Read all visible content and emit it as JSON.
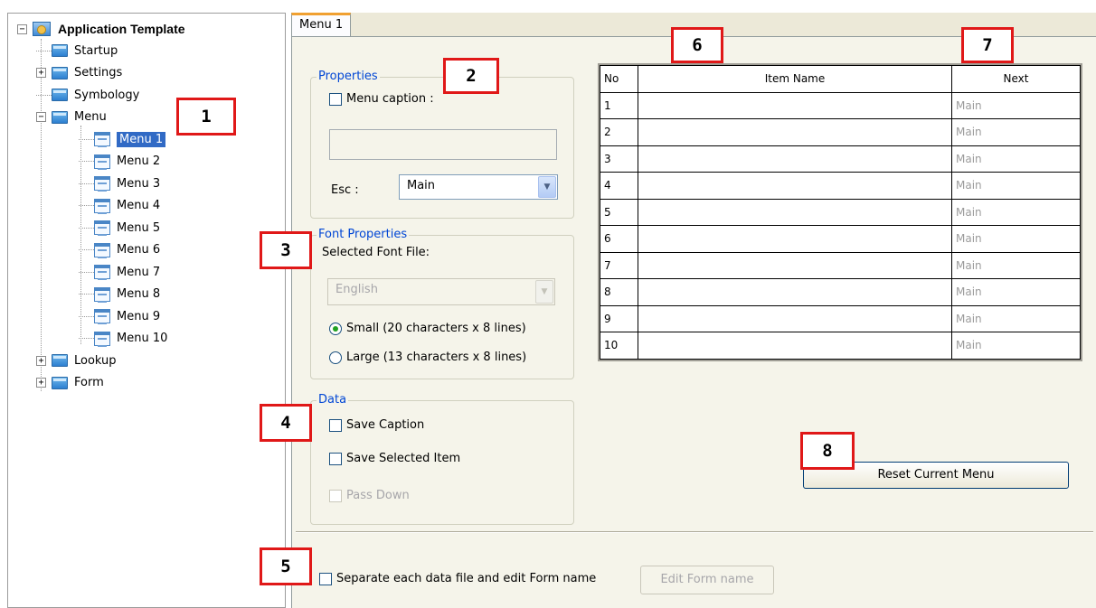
{
  "tree": {
    "root": "Application Template",
    "items": [
      {
        "label": "Startup",
        "expander": ""
      },
      {
        "label": "Settings",
        "expander": "+"
      },
      {
        "label": "Symbology",
        "expander": ""
      },
      {
        "label": "Menu",
        "expander": "−"
      }
    ],
    "menus": [
      "Menu 1",
      "Menu 2",
      "Menu 3",
      "Menu 4",
      "Menu 5",
      "Menu 6",
      "Menu 7",
      "Menu 8",
      "Menu 9",
      "Menu 10"
    ],
    "selected": "Menu 1",
    "after": [
      {
        "label": "Lookup",
        "expander": "+"
      },
      {
        "label": "Form",
        "expander": "+"
      }
    ]
  },
  "tab": {
    "label": "Menu 1"
  },
  "properties": {
    "title": "Properties",
    "menu_caption_label": "Menu caption :",
    "menu_caption_checked": false,
    "caption_value": "",
    "esc_label": "Esc :",
    "esc_value": "Main"
  },
  "font_properties": {
    "title": "Font Properties",
    "selected_font_label": "Selected Font File:",
    "font_value": "English",
    "small_label": "Small (20 characters x 8 lines)",
    "large_label": "Large (13 characters x 8 lines)",
    "selected_size": "small"
  },
  "data_group": {
    "title": "Data",
    "save_caption": "Save Caption",
    "save_selected_item": "Save Selected Item",
    "pass_down": "Pass Down"
  },
  "grid": {
    "columns": [
      "No",
      "Item Name",
      "Next"
    ],
    "rows": [
      {
        "no": "1",
        "item": "",
        "next": "Main"
      },
      {
        "no": "2",
        "item": "",
        "next": "Main"
      },
      {
        "no": "3",
        "item": "",
        "next": "Main"
      },
      {
        "no": "4",
        "item": "",
        "next": "Main"
      },
      {
        "no": "5",
        "item": "",
        "next": "Main"
      },
      {
        "no": "6",
        "item": "",
        "next": "Main"
      },
      {
        "no": "7",
        "item": "",
        "next": "Main"
      },
      {
        "no": "8",
        "item": "",
        "next": "Main"
      },
      {
        "no": "9",
        "item": "",
        "next": "Main"
      },
      {
        "no": "10",
        "item": "",
        "next": "Main"
      }
    ]
  },
  "reset_button": "Reset Current Menu",
  "separate_files_label": "Separate each data file and edit Form name",
  "edit_form_button": "Edit Form name",
  "callouts": [
    "1",
    "2",
    "3",
    "4",
    "5",
    "6",
    "7",
    "8"
  ],
  "colors": {
    "callout_border": "#e01818",
    "selection": "#316ac5",
    "group_title": "#0046d5"
  }
}
